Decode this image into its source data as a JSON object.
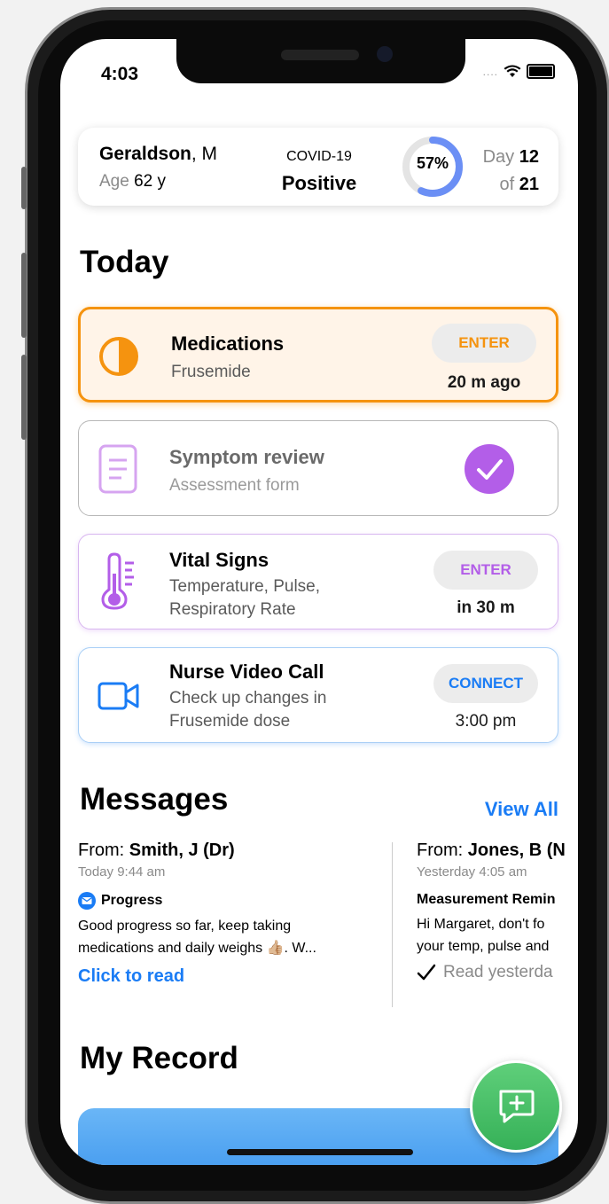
{
  "status": {
    "time": "4:03",
    "signal": "....",
    "wifi": "wifi"
  },
  "patient": {
    "surname": "Geraldson",
    "initial": ", M",
    "age_label": "Age",
    "age_value": "62 y",
    "condition": "COVID-19",
    "result": "Positive",
    "progress_label": "57%",
    "progress_fraction": 0.57,
    "day_label": "Day",
    "day_value": "12",
    "of_label": "of",
    "of_value": "21"
  },
  "today": {
    "title": "Today",
    "cards": [
      {
        "title": "Medications",
        "subtitle": "Frusemide",
        "action": "ENTER",
        "when": "20 m ago",
        "icon": "half-circle-icon"
      },
      {
        "title": "Symptom review",
        "subtitle": "Assessment form",
        "status": "completed",
        "icon": "document-icon"
      },
      {
        "title": "Vital Signs",
        "subtitle_1": "Temperature, Pulse,",
        "subtitle_2": "Respiratory Rate",
        "action": "ENTER",
        "when": "in 30 m",
        "icon": "thermometer-icon"
      },
      {
        "title": "Nurse Video Call",
        "subtitle_1": "Check up changes in",
        "subtitle_2": "Frusemide dose",
        "action": "CONNECT",
        "when": "3:00 pm",
        "icon": "video-camera-icon"
      }
    ]
  },
  "messages": {
    "title": "Messages",
    "view_all": "View All",
    "items": [
      {
        "from_label": "From:",
        "sender": "Smith, J (Dr)",
        "time": "Today 9:44 am",
        "subject": "Progress",
        "body_1": "Good progress so far, keep taking",
        "body_2": "medications and daily weighs 👍🏼. W...",
        "link": "Click to read"
      },
      {
        "from_label": "From:",
        "sender": "Jones, B (N",
        "time": "Yesterday 4:05 am",
        "subject": "Measurement Remin",
        "body_1": "Hi Margaret, don't fo",
        "body_2": "your temp, pulse and",
        "read": "Read yesterda"
      }
    ]
  },
  "record": {
    "title": "My Record"
  },
  "colors": {
    "accent": "#1a7cf5",
    "medication": "#f5930f",
    "symptom": "#b35ee8",
    "vitals": "#b35ee8",
    "video": "#1a7cf5",
    "fab": "#3fbf62"
  }
}
